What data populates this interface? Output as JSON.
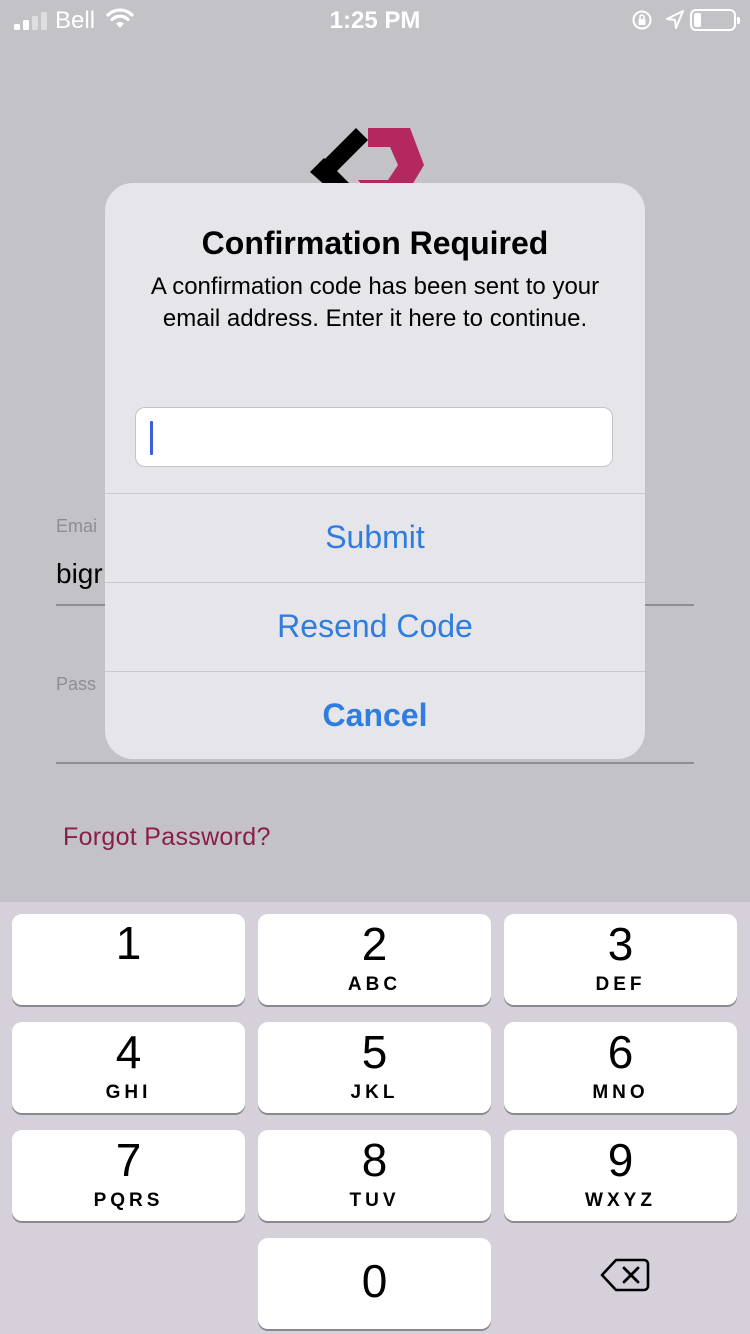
{
  "status_bar": {
    "carrier": "Bell",
    "time": "1:25 PM",
    "signal_bars_filled": 2,
    "signal_bars_total": 4,
    "battery_level": 0.15
  },
  "login": {
    "email_label": "Emai",
    "email_value": "bigr",
    "password_label": "Pass",
    "forgot_password": "Forgot Password?"
  },
  "alert": {
    "title": "Confirmation Required",
    "message": "A confirmation code has been sent to your email address. Enter it here to continue.",
    "input_value": "",
    "buttons": {
      "submit": "Submit",
      "resend": "Resend Code",
      "cancel": "Cancel"
    }
  },
  "keypad": {
    "keys": [
      {
        "num": "1",
        "letters": ""
      },
      {
        "num": "2",
        "letters": "ABC"
      },
      {
        "num": "3",
        "letters": "DEF"
      },
      {
        "num": "4",
        "letters": "GHI"
      },
      {
        "num": "5",
        "letters": "JKL"
      },
      {
        "num": "6",
        "letters": "MNO"
      },
      {
        "num": "7",
        "letters": "PQRS"
      },
      {
        "num": "8",
        "letters": "TUV"
      },
      {
        "num": "9",
        "letters": "WXYZ"
      },
      {
        "num": "0",
        "letters": ""
      }
    ],
    "backspace_icon": "backspace-icon"
  },
  "colors": {
    "accent": "#2f7de1",
    "brand": "#8a1e4a",
    "logo_pink": "#b5285f"
  }
}
